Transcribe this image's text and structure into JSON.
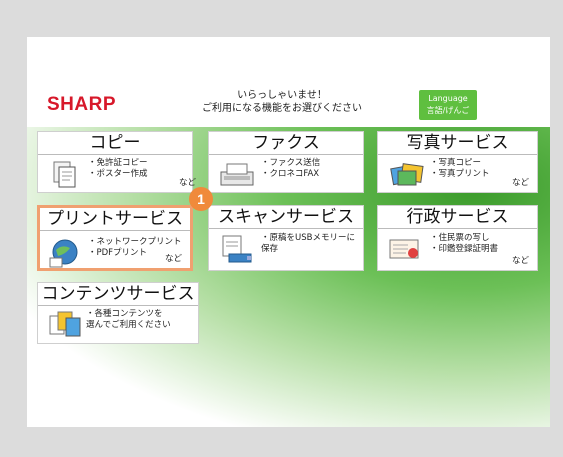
{
  "header": {
    "logo": "SHARP",
    "welcome_line1": "いらっしゃいませ！",
    "welcome_line2": "ご利用になる機能をお選びください",
    "language_line1": "Language",
    "language_line2": "言語/げんご"
  },
  "tiles": [
    {
      "title": "コピー",
      "desc": "・免許証コピー\n・ポスター作成",
      "nado": "など",
      "icon": "copy-icon"
    },
    {
      "title": "ファクス",
      "desc": "・ファクス送信\n・クロネコFAX",
      "nado": "",
      "icon": "fax-icon"
    },
    {
      "title": "写真サービス",
      "desc": "・写真コピー\n・写真プリント",
      "nado": "など",
      "icon": "photo-icon"
    },
    {
      "title": "プリントサービス",
      "desc": "・ネットワークプリント\n・PDFプリント",
      "nado": "など",
      "icon": "print-icon"
    },
    {
      "title": "スキャンサービス",
      "desc": "・原稿をUSBメモリーに\n保存",
      "nado": "",
      "icon": "scan-icon"
    },
    {
      "title": "行政サービス",
      "desc": "・住民票の写し\n・印鑑登録証明書",
      "nado": "など",
      "icon": "government-icon"
    },
    {
      "title": "コンテンツサービス",
      "desc": "・各種コンテンツを\n選んでご利用ください",
      "nado": "",
      "icon": "contents-icon"
    }
  ],
  "badge": "1",
  "colors": {
    "brand": "#d7182a",
    "accent_green": "#5fbf3f",
    "highlight": "#f08a3b"
  }
}
